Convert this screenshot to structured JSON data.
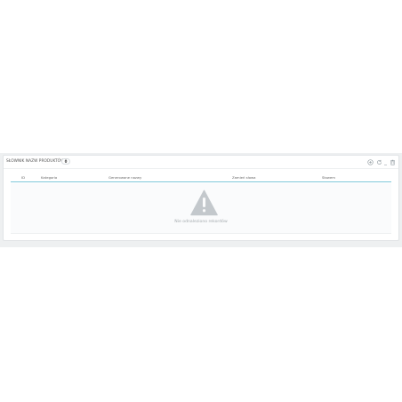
{
  "panel": {
    "title": "SŁOWNIK NAZW PRODUKTÓW",
    "count": "0"
  },
  "toolbar": {
    "icons": [
      "add-icon",
      "refresh-icon",
      "more-icon",
      "trash-icon"
    ]
  },
  "table": {
    "columns": [
      "ID",
      "Kategoria",
      "Generowane nazwy",
      "Zamień słowa",
      "Słowem"
    ],
    "rows": []
  },
  "empty_state": {
    "message": "Nie odnaleziono rekordów",
    "icon": "warning-icon"
  },
  "colors": {
    "background": "#eef0f1",
    "header_underline": "#7fc7d9",
    "icon": "#c3c8cc"
  }
}
